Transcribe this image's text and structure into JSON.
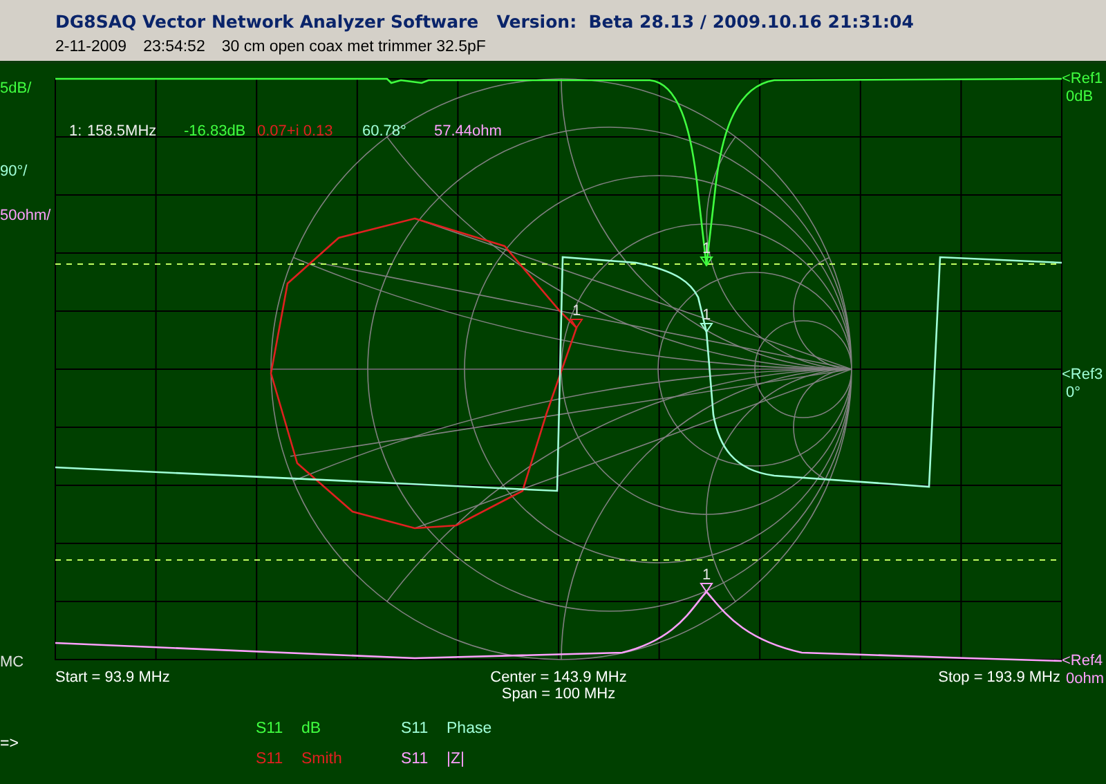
{
  "window": {
    "title": "DG8SAQ Vector Network Analyzer Software   Version:  Beta 28.13 / 2009.10.16 21:31:04"
  },
  "header": {
    "date": "2-11-2009",
    "time": "23:54:52",
    "description": "30 cm open coax met trimmer 32.5pF"
  },
  "scales": [
    {
      "text": "5dB/",
      "color": "#40ff40"
    },
    {
      "text": "90°/",
      "color": "#a0ffd8"
    },
    {
      "text": "50ohm/",
      "color": "#ffa0ff"
    }
  ],
  "marker_readout": {
    "label": "1:",
    "frequency": "158.5MHz",
    "values": [
      {
        "text": "-16.83dB",
        "color": "#40ff40"
      },
      {
        "text": "0.07+i 0.13",
        "color": "#e02020"
      },
      {
        "text": "60.78°",
        "color": "#a0ffd8"
      },
      {
        "text": "57.44ohm",
        "color": "#ffa0ff"
      }
    ]
  },
  "references": [
    {
      "label": "<Ref1",
      "value": "0dB",
      "color": "#40ff40"
    },
    {
      "label": "<Ref3",
      "value": "0°",
      "color": "#a0ffd8"
    },
    {
      "label": "<Ref4",
      "value": "0ohm",
      "color": "#ffa0ff"
    }
  ],
  "mode": "MC",
  "frequency_axis": {
    "start": "Start = 93.9 MHz",
    "center": "Center = 143.9 MHz",
    "span": "Span = 100 MHz",
    "stop": "Stop = 193.9 MHz"
  },
  "traces": [
    {
      "kind": "db",
      "marker": "1",
      "color": "#40ff40"
    },
    {
      "kind": "smith",
      "marker": "1",
      "color": "#e02020"
    },
    {
      "kind": "phase",
      "marker": "1",
      "color": "#a0ffd8"
    },
    {
      "kind": "impedance",
      "marker": "1",
      "color": "#ffa0ff"
    }
  ],
  "prompt": "=>",
  "legend": [
    {
      "parameter": "S11",
      "format": "dB",
      "color": "#40ff40"
    },
    {
      "parameter": "S11",
      "format": "Phase",
      "color": "#a0ffd8"
    },
    {
      "parameter": "S11",
      "format": "Smith",
      "color": "#e02020"
    },
    {
      "parameter": "S11",
      "format": "|Z|",
      "color": "#ffa0ff"
    }
  ]
}
